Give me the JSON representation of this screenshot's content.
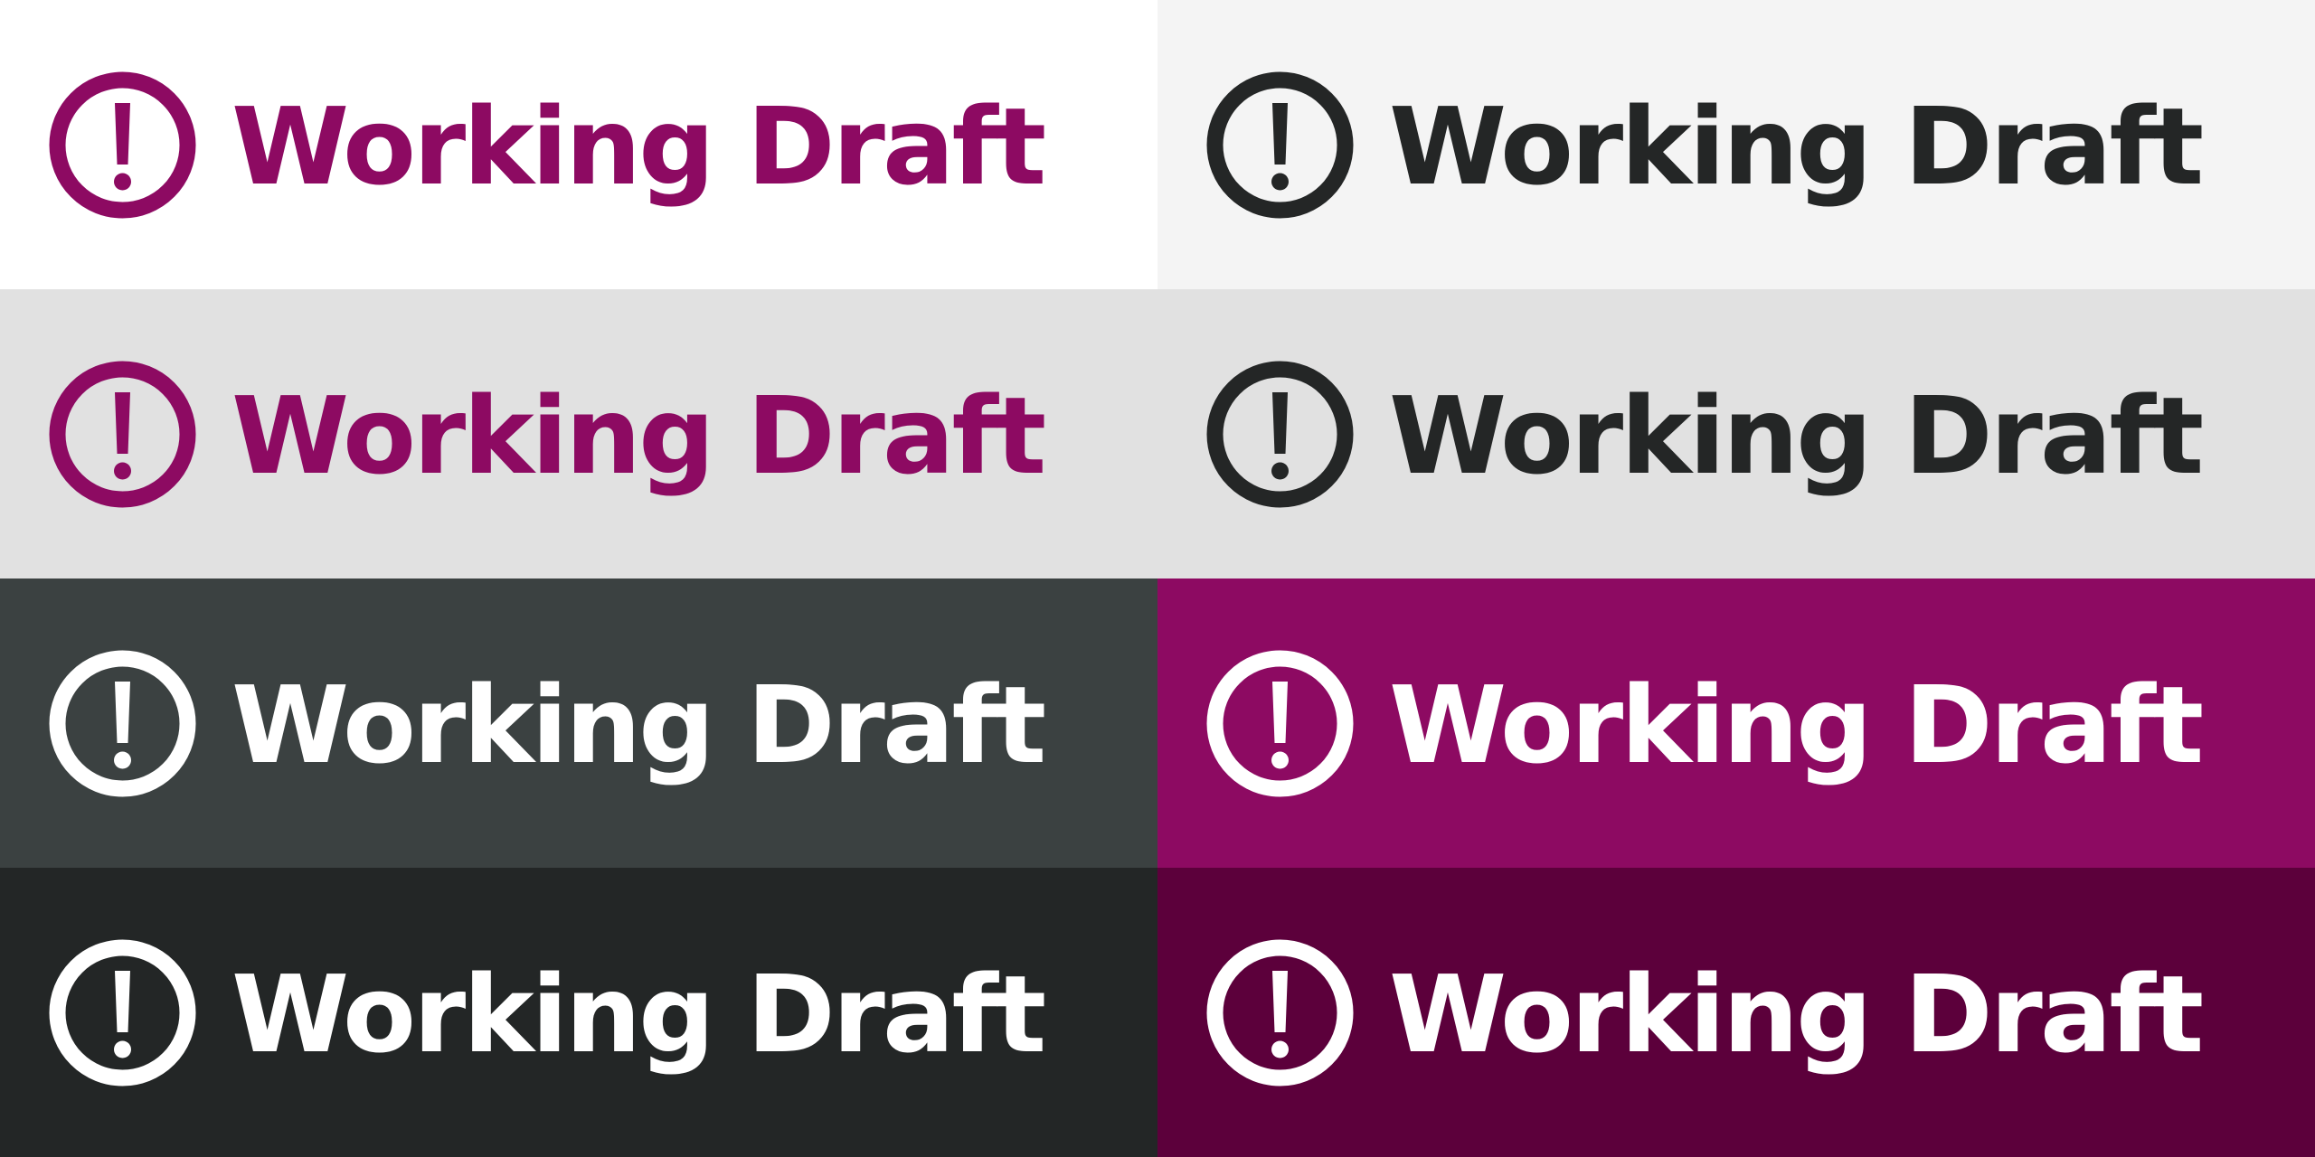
{
  "label_text": "Working Draft",
  "icon": "exclamation-circle-icon",
  "tiles": [
    {
      "variant": "light-white",
      "background": "#ffffff",
      "foreground": "#8d0a62"
    },
    {
      "variant": "light-gray",
      "background": "#f4f4f4",
      "foreground": "#242626"
    },
    {
      "variant": "mid-gray",
      "background": "#e1e1e1",
      "foreground": "#8d0a62"
    },
    {
      "variant": "mid-gray-dark",
      "background": "#e1e1e1",
      "foreground": "#242626"
    },
    {
      "variant": "slate",
      "background": "#3b4141",
      "foreground": "#ffffff"
    },
    {
      "variant": "magenta",
      "background": "#8d0a62",
      "foreground": "#ffffff"
    },
    {
      "variant": "charcoal",
      "background": "#232626",
      "foreground": "#ffffff"
    },
    {
      "variant": "plum",
      "background": "#5c003b",
      "foreground": "#ffffff"
    }
  ]
}
